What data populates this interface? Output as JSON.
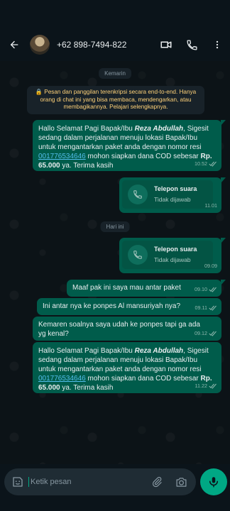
{
  "header": {
    "contact": "+62 898-7494-822"
  },
  "chat": {
    "date_yesterday": "Kemarin",
    "encryption_notice": "🔒 Pesan dan panggilan terenkripsi secara end-to-end. Hanya orang di chat ini yang bisa membaca, mendengarkan, atau membagikannya. Pelajari selengkapnya.",
    "msg1": {
      "pre": "Hallo Selamat Pagi Bapak/Ibu ",
      "name": "Reza Abdullah",
      "mid": ", Sigesit sedang dalam perjalanan menuju lokasi Bapak/Ibu untuk mengantarkan paket anda dengan nomor resi ",
      "resi": "001776534646",
      "post": " mohon siapkan dana COD sebesar ",
      "amount": "Rp. 65.000",
      "end": " ya. Terima kasih",
      "time": "10.52"
    },
    "call1": {
      "title": "Telepon suara",
      "status": "Tidak dijawab",
      "time": "11.01"
    },
    "date_today": "Hari ini",
    "call2": {
      "title": "Telepon suara",
      "status": "Tidak dijawab",
      "time": "09.09"
    },
    "msg2": {
      "text": "Maaf pak ini saya mau antar paket",
      "time": "09.10"
    },
    "msg3": {
      "text": "Ini antar nya ke ponpes Al mansuriyah nya?",
      "time": "09.11"
    },
    "msg4": {
      "text": "Kemaren soalnya saya udah ke ponpes tapi ga ada yg kenal?",
      "time": "09.12"
    },
    "msg5": {
      "pre": "Hallo Selamat Pagi Bapak/Ibu ",
      "name": "Reza Abdullah",
      "mid": ", Sigesit sedang dalam perjalanan menuju lokasi Bapak/Ibu untuk mengantarkan paket anda dengan nomor resi ",
      "resi": "001776534646",
      "post": " mohon siapkan dana COD sebesar ",
      "amount": "Rp. 65.000",
      "end": " ya. Terima kasih",
      "time": "11.22"
    }
  },
  "input": {
    "placeholder": "Ketik pesan"
  },
  "colors": {
    "outgoing": "#005c4b",
    "accent": "#00a884",
    "link": "#53bdeb",
    "notice": "#ffd279"
  }
}
